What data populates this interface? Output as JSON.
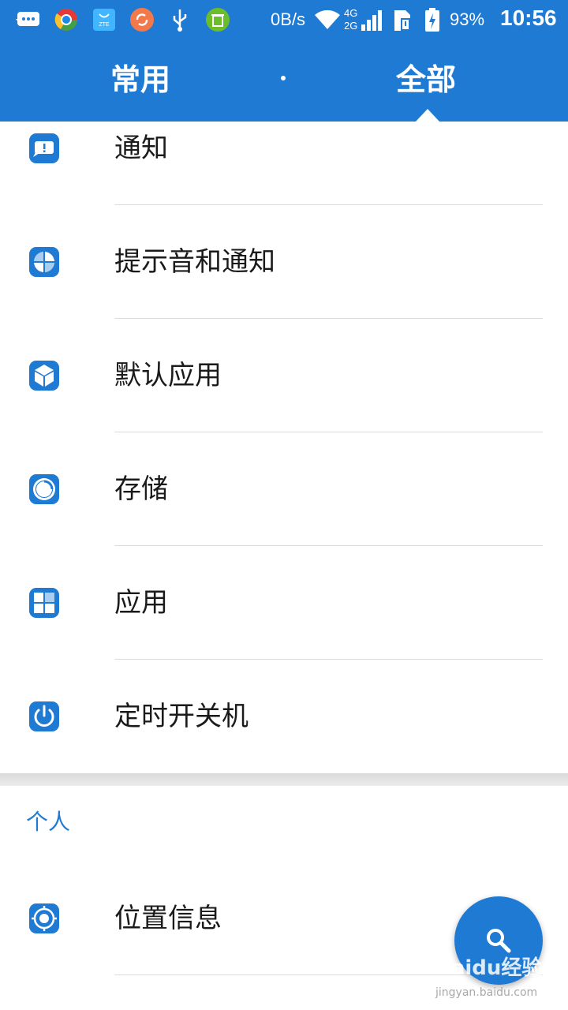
{
  "status_bar": {
    "network_speed": "0B/s",
    "network_type_top": "4G",
    "network_type_bottom": "2G",
    "battery_percent": "93%",
    "time": "10:56",
    "notification_icons": [
      "message-icon",
      "chrome-like-icon",
      "zte-store-icon",
      "sync-icon",
      "usb-icon",
      "cleaner-icon"
    ]
  },
  "tabs": [
    {
      "label": "常用",
      "selected": false
    },
    {
      "label": "全部",
      "selected": true
    }
  ],
  "settings_items": [
    {
      "label": "通知",
      "icon": "notification-icon"
    },
    {
      "label": "提示音和通知",
      "icon": "sound-icon"
    },
    {
      "label": "默认应用",
      "icon": "default-apps-icon"
    },
    {
      "label": "存储",
      "icon": "storage-icon"
    },
    {
      "label": "应用",
      "icon": "apps-icon"
    },
    {
      "label": "定时开关机",
      "icon": "power-icon"
    }
  ],
  "personal_section": {
    "header": "个人",
    "items": [
      {
        "label": "位置信息",
        "icon": "location-icon"
      }
    ]
  },
  "fab": {
    "icon": "search-icon"
  },
  "watermark": {
    "text": "Baidu经验",
    "sub": "jingyan.baidu.com"
  },
  "colors": {
    "accent": "#1f7ad3",
    "divider": "#dcdcdc",
    "text": "#1a1a1a"
  }
}
